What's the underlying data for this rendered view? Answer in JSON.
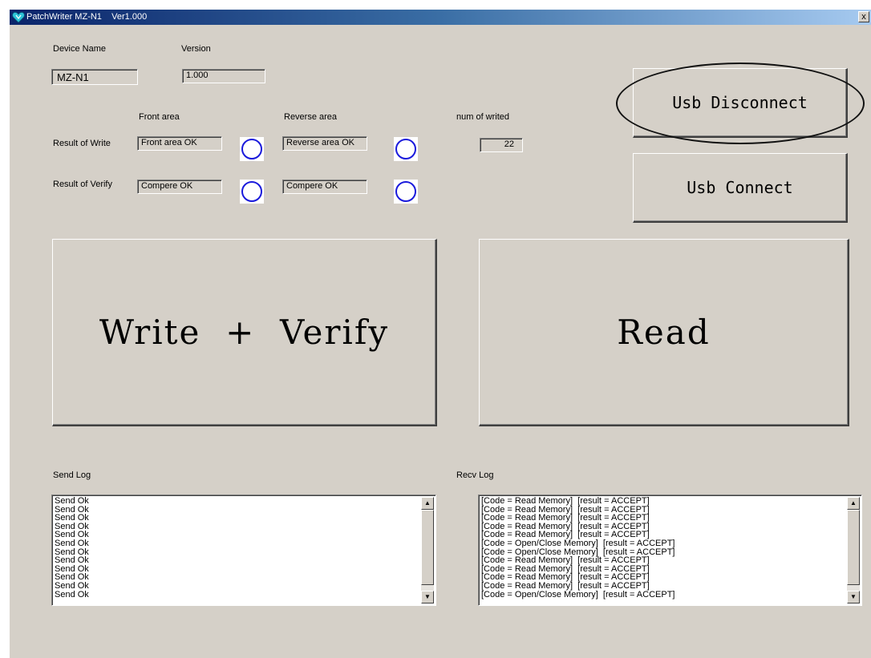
{
  "window": {
    "app_name": "PatchWriter MZ-N1",
    "version_text": "Ver1.000",
    "close_glyph": "x",
    "icon": "heart-app-icon"
  },
  "device": {
    "name_label": "Device Name",
    "name_value": "MZ-N1",
    "version_label": "Version",
    "version_value": "1.000"
  },
  "results": {
    "front_area_label": "Front area",
    "reverse_area_label": "Reverse area",
    "num_label": "num of writed",
    "num_value": "22",
    "write_label": "Result of Write",
    "write_front": "Front area OK",
    "write_reverse": "Reverse area OK",
    "verify_label": "Result of Verify",
    "verify_front": "Compere OK",
    "verify_reverse": "Compere OK",
    "lamp_color": "#1a1adc"
  },
  "buttons": {
    "usb_disconnect": "Usb Disconnect",
    "usb_connect": "Usb Connect",
    "write_verify": "Write  +  Verify",
    "read": "Read"
  },
  "send_log": {
    "label": "Send Log",
    "lines": [
      "Send Ok",
      "Send Ok",
      "Send Ok",
      "Send Ok",
      "Send Ok",
      "Send Ok",
      "Send Ok",
      "Send Ok",
      "Send Ok",
      "Send Ok",
      "Send Ok",
      "Send Ok"
    ]
  },
  "recv_log": {
    "label": "Recv Log",
    "lines": [
      "[Code = Read Memory]  [result = ACCEPT]",
      "[Code = Read Memory]  [result = ACCEPT]",
      "[Code = Read Memory]  [result = ACCEPT]",
      "[Code = Read Memory]  [result = ACCEPT]",
      "[Code = Read Memory]  [result = ACCEPT]",
      "[Code = Open/Close Memory]  [result = ACCEPT]",
      "[Code = Open/Close Memory]  [result = ACCEPT]",
      "[Code = Read Memory]  [result = ACCEPT]",
      "[Code = Read Memory]  [result = ACCEPT]",
      "[Code = Read Memory]  [result = ACCEPT]",
      "[Code = Read Memory]  [result = ACCEPT]",
      "[Code = Open/Close Memory]  [result = ACCEPT]"
    ]
  }
}
